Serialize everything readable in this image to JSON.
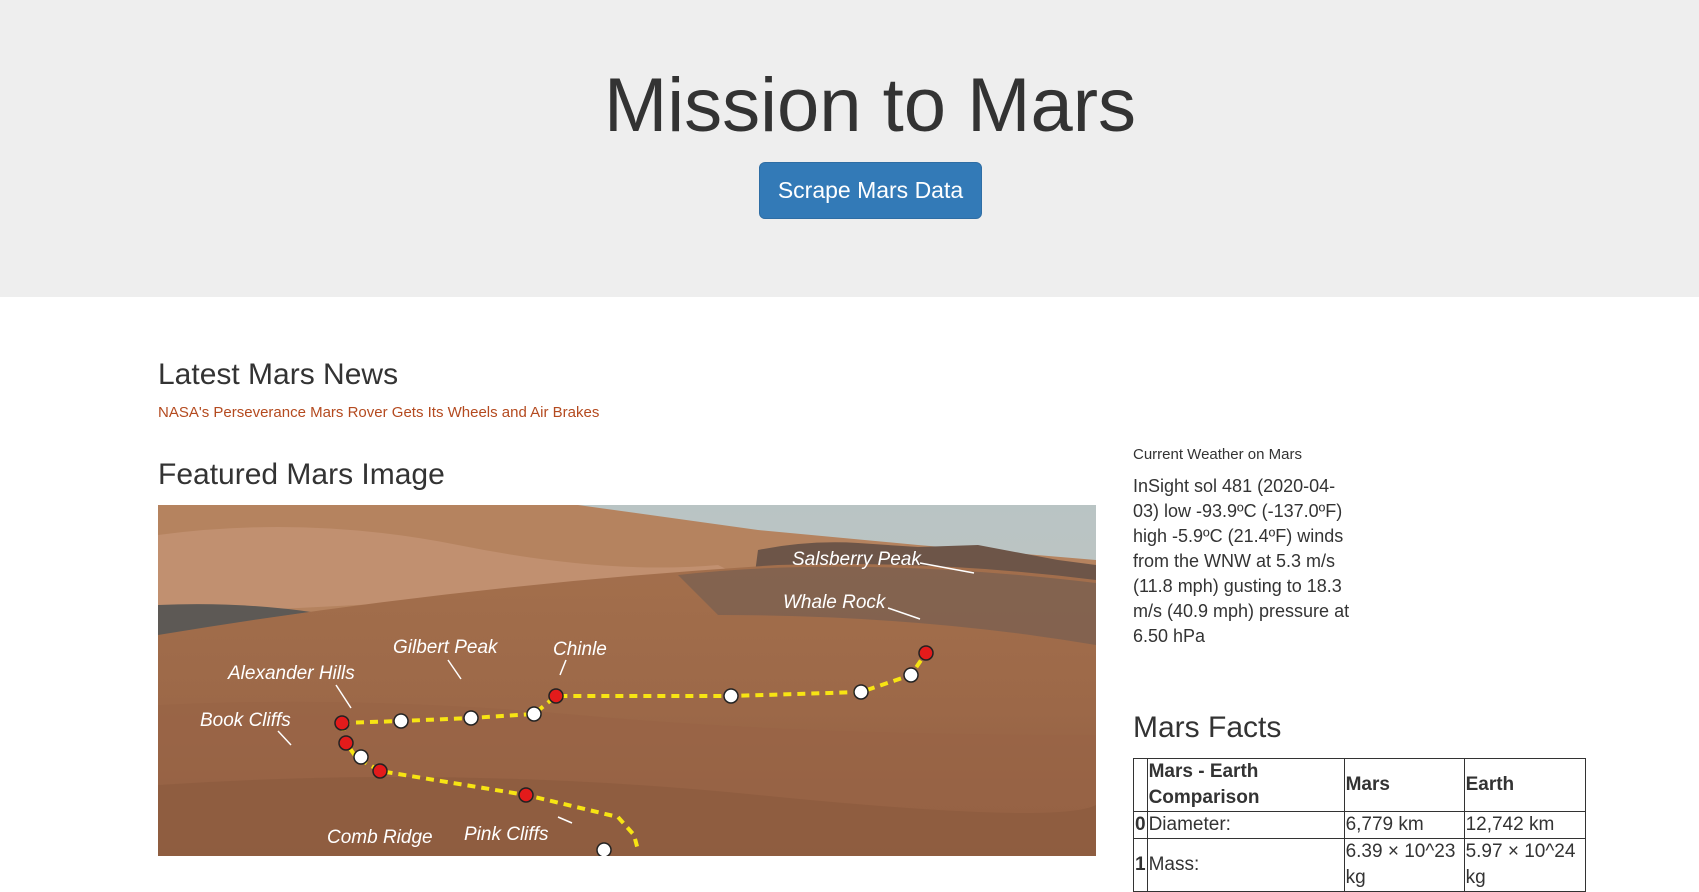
{
  "header": {
    "title": "Mission to Mars",
    "scrape_button": "Scrape Mars Data"
  },
  "news": {
    "section_title": "Latest Mars News",
    "headline": "NASA's Perseverance Mars Rover Gets Its Wheels and Air Brakes"
  },
  "featured": {
    "section_title": "Featured Mars Image",
    "labels": {
      "salsberry": "Salsberry Peak",
      "whale": "Whale Rock",
      "gilbert": "Gilbert Peak",
      "chinle": "Chinle",
      "alexander": "Alexander Hills",
      "book": "Book Cliffs",
      "comb": "Comb Ridge",
      "pink": "Pink Cliffs"
    }
  },
  "weather": {
    "label": "Current Weather on Mars",
    "text": "InSight sol 481 (2020-04-03) low -93.9ºC (-137.0ºF) high -5.9ºC (21.4ºF) winds from the WNW at 5.3 m/s (11.8 mph) gusting to 18.3 m/s (40.9 mph) pressure at 6.50 hPa"
  },
  "facts": {
    "section_title": "Mars Facts",
    "headers": [
      "",
      "Mars - Earth Comparison",
      "Mars",
      "Earth"
    ],
    "rows": [
      [
        "0",
        "Diameter:",
        "6,779 km",
        "12,742 km"
      ],
      [
        "1",
        "Mass:",
        "6.39 × 10^23 kg",
        "5.97 × 10^24 kg"
      ]
    ]
  },
  "colors": {
    "jumbotron_bg": "#eeeeee",
    "button_bg": "#337ab7",
    "link_color": "#b44a1f",
    "text_color": "#333333"
  }
}
